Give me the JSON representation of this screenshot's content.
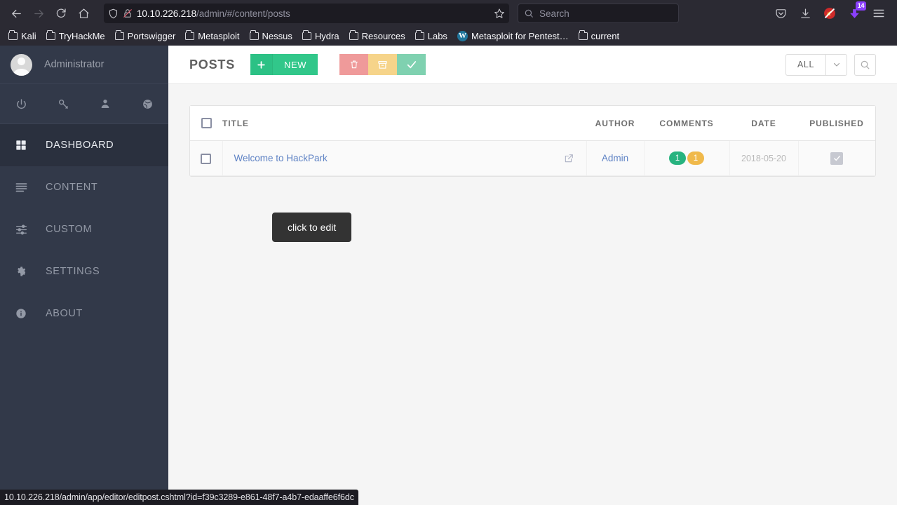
{
  "browser": {
    "nav": {
      "back_icon": "back-arrow-icon",
      "forward_icon": "forward-arrow-icon",
      "reload_icon": "reload-icon",
      "home_icon": "home-icon"
    },
    "url": {
      "host": "10.10.226.218",
      "path": "/admin/#/content/posts",
      "shield_icon": "shield-icon",
      "lock_broken_icon": "lock-crossed-icon",
      "bookmark_star_icon": "star-icon"
    },
    "search": {
      "placeholder": "Search",
      "icon": "search-icon"
    },
    "toolbar": {
      "pocket_icon": "pocket-icon",
      "downloads_icon": "download-icon",
      "noscript_icon": "noscript-icon",
      "extension_icon": "extension-icon",
      "extension_badge": "14",
      "menu_icon": "hamburger-menu-icon"
    },
    "bookmarks": [
      {
        "label": "Kali",
        "icon": "folder-icon"
      },
      {
        "label": "TryHackMe",
        "icon": "folder-icon"
      },
      {
        "label": "Portswigger",
        "icon": "folder-icon"
      },
      {
        "label": "Metasploit",
        "icon": "folder-icon"
      },
      {
        "label": "Nessus",
        "icon": "folder-icon"
      },
      {
        "label": "Hydra",
        "icon": "folder-icon"
      },
      {
        "label": "Resources",
        "icon": "folder-icon"
      },
      {
        "label": "Labs",
        "icon": "folder-icon"
      },
      {
        "label": "Metasploit for Pentest…",
        "icon": "wordpress-icon"
      },
      {
        "label": "current",
        "icon": "folder-icon"
      }
    ],
    "status_bar": {
      "host": "10.10.226.218",
      "rest": "/admin/app/editor/editpost.cshtml?id=f39c3289-e861-48f7-a4b7-edaaffe6f6dc"
    }
  },
  "sidebar": {
    "user": {
      "name": "Administrator",
      "avatar_icon": "user-avatar-icon"
    },
    "quick_icons": [
      {
        "name": "power-icon"
      },
      {
        "name": "key-icon"
      },
      {
        "name": "user-icon"
      },
      {
        "name": "globe-icon"
      }
    ],
    "items": [
      {
        "label": "DASHBOARD",
        "icon": "grid-icon",
        "active": true
      },
      {
        "label": "CONTENT",
        "icon": "list-icon",
        "active": false
      },
      {
        "label": "CUSTOM",
        "icon": "sliders-icon",
        "active": false
      },
      {
        "label": "SETTINGS",
        "icon": "gear-icon",
        "active": false
      },
      {
        "label": "ABOUT",
        "icon": "info-icon",
        "active": false
      }
    ]
  },
  "page": {
    "title": "POSTS",
    "actions": {
      "new_label": "NEW",
      "plus_icon": "plus-icon",
      "delete_icon": "trash-icon",
      "archive_icon": "archive-icon",
      "publish_icon": "check-icon"
    },
    "filter": {
      "selected": "ALL",
      "caret_icon": "chevron-down-icon",
      "search_icon": "search-icon"
    },
    "table": {
      "columns": [
        "TITLE",
        "AUTHOR",
        "COMMENTS",
        "DATE",
        "PUBLISHED"
      ],
      "rows": [
        {
          "title": "Welcome to HackPark",
          "external_icon": "external-link-icon",
          "author": "Admin",
          "comments_approved": "1",
          "comments_pending": "1",
          "date": "2018-05-20",
          "published": true,
          "published_icon": "checkbox-checked-icon"
        }
      ]
    },
    "tooltip": "click to edit"
  },
  "colors": {
    "accent_green": "#2cc185",
    "delete_red": "#ef9a9a",
    "archive_yellow": "#f6d48a",
    "publish_green": "#7fd1b0",
    "sidebar_bg": "#323949",
    "sidebar_active": "#2a303e",
    "link_blue": "#5e82c4",
    "pill_green": "#27b37f",
    "pill_yellow": "#f0b94b"
  }
}
